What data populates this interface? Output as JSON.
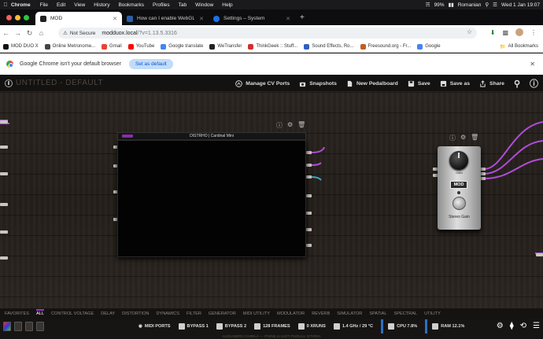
{
  "menubar": {
    "app": "Chrome",
    "items": [
      "File",
      "Edit",
      "View",
      "History",
      "Bookmarks",
      "Profiles",
      "Tab",
      "Window",
      "Help"
    ],
    "battery": "99%",
    "input_source": "Romanian",
    "clock": "Wed 1 Jan  19:07"
  },
  "tabs": [
    {
      "title": "MOD",
      "favicon_color": "#222222"
    },
    {
      "title": "How can I enable WebGL in o",
      "favicon_color": "#2b5fa8"
    },
    {
      "title": "Settings – System",
      "favicon_color": "#1a73e8"
    }
  ],
  "newtab": "+",
  "address": {
    "security": "Not Secure",
    "host": "modduox.local",
    "path": "/?v=1.13.5.3316"
  },
  "bookmarks": [
    {
      "label": "MOD DUO X",
      "color": "#111111"
    },
    {
      "label": "Online Metronome...",
      "color": "#444444"
    },
    {
      "label": "Gmail",
      "color": "#ea4335"
    },
    {
      "label": "YouTube",
      "color": "#ff0000"
    },
    {
      "label": "Google translate",
      "color": "#4285f4"
    },
    {
      "label": "WeTransfer",
      "color": "#222222"
    },
    {
      "label": "ThinkGeek :: Stuff...",
      "color": "#d03030"
    },
    {
      "label": "Sound Effects, Ro...",
      "color": "#3060c0"
    },
    {
      "label": "Freesound.org - Fr...",
      "color": "#c06020"
    },
    {
      "label": "Google",
      "color": "#4285f4"
    }
  ],
  "all_bookmarks": "All Bookmarks",
  "infobar": {
    "message": "Google Chrome isn't your default browser",
    "button": "Set as default"
  },
  "mod": {
    "title": "UNTITLED - DEFAULT",
    "toolbar": [
      "Manage CV Ports",
      "Snapshots",
      "New Pedalboard",
      "Save",
      "Save as",
      "Share"
    ],
    "plugin_title": "DISTRHO | Cardinal Mini",
    "pedal": {
      "knob_label": "GAIN",
      "badge": "MOD",
      "name": "Stereo Gain"
    },
    "categories": [
      "FAVORITES",
      "ALL",
      "CONTROL VOLTAGE",
      "DELAY",
      "DISTORTION",
      "DYNAMICS",
      "FILTER",
      "GENERATOR",
      "MIDI UTILITY",
      "MODULATOR",
      "REVERB",
      "SIMULATOR",
      "SPATIAL",
      "SPECTRAL",
      "UTILITY"
    ],
    "selected_category": "ALL",
    "status": [
      "MIDI PORTS",
      "BYPASS 1",
      "BYPASS 2",
      "128 FRAMES",
      "0 XRUNS",
      "1.4 GHz / 29 °C",
      "CPU 7.8%",
      "RAM 12.1%"
    ],
    "credit": "ALEXANDRU CHIRILĂ — ITHINK.ro IUSTI PUDULU ISTORIA"
  },
  "colors": {
    "accent": "#9b2fd0",
    "cable": "#b04cd8",
    "cpu_bar": "#2d6fc7"
  }
}
